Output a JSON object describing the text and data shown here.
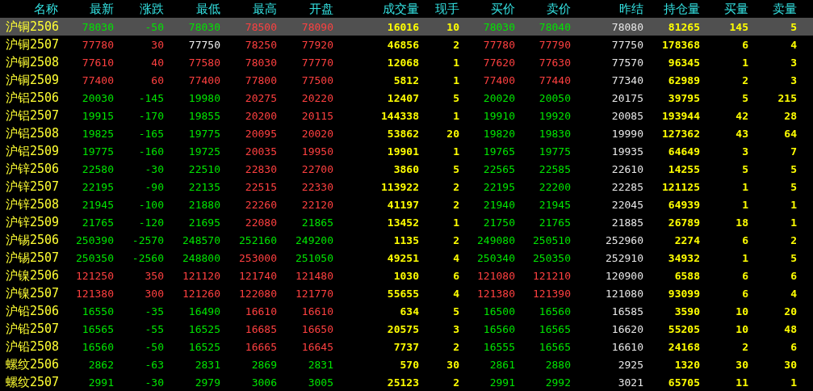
{
  "table": {
    "columns": [
      {
        "label": "名称",
        "kind": "name"
      },
      {
        "label": "最新",
        "kind": "price"
      },
      {
        "label": "涨跌",
        "kind": "price"
      },
      {
        "label": "最低",
        "kind": "price"
      },
      {
        "label": "最高",
        "kind": "price"
      },
      {
        "label": "开盘",
        "kind": "price"
      },
      {
        "label": "成交量",
        "kind": "volume"
      },
      {
        "label": "现手",
        "kind": "volume"
      },
      {
        "label": "买价",
        "kind": "price"
      },
      {
        "label": "卖价",
        "kind": "price"
      },
      {
        "label": "昨结",
        "kind": "ref"
      },
      {
        "label": "持仓量",
        "kind": "volume"
      },
      {
        "label": "买量",
        "kind": "volume"
      },
      {
        "label": "卖量",
        "kind": "volume"
      }
    ],
    "rows": [
      {
        "selected": true,
        "cells": [
          {
            "text": "沪铜2506"
          },
          {
            "text": "78030",
            "color": "#00e600"
          },
          {
            "text": "-50",
            "color": "#00e600"
          },
          {
            "text": "78030",
            "color": "#00e600"
          },
          {
            "text": "78500",
            "color": "#ff4040"
          },
          {
            "text": "78090",
            "color": "#ff4040"
          },
          {
            "text": "16016"
          },
          {
            "text": "10"
          },
          {
            "text": "78030",
            "color": "#00e600"
          },
          {
            "text": "78040",
            "color": "#00e600"
          },
          {
            "text": "78080"
          },
          {
            "text": "81265"
          },
          {
            "text": "145"
          },
          {
            "text": "5"
          }
        ]
      },
      {
        "selected": false,
        "cells": [
          {
            "text": "沪铜2507"
          },
          {
            "text": "77780",
            "color": "#ff4040"
          },
          {
            "text": "30",
            "color": "#ff4040"
          },
          {
            "text": "77750",
            "color": "#f0f0f0"
          },
          {
            "text": "78250",
            "color": "#ff4040"
          },
          {
            "text": "77920",
            "color": "#ff4040"
          },
          {
            "text": "46856"
          },
          {
            "text": "2"
          },
          {
            "text": "77780",
            "color": "#ff4040"
          },
          {
            "text": "77790",
            "color": "#ff4040"
          },
          {
            "text": "77750"
          },
          {
            "text": "178368"
          },
          {
            "text": "6"
          },
          {
            "text": "4"
          }
        ]
      },
      {
        "selected": false,
        "cells": [
          {
            "text": "沪铜2508"
          },
          {
            "text": "77610",
            "color": "#ff4040"
          },
          {
            "text": "40",
            "color": "#ff4040"
          },
          {
            "text": "77580",
            "color": "#ff4040"
          },
          {
            "text": "78030",
            "color": "#ff4040"
          },
          {
            "text": "77770",
            "color": "#ff4040"
          },
          {
            "text": "12068"
          },
          {
            "text": "1"
          },
          {
            "text": "77620",
            "color": "#ff4040"
          },
          {
            "text": "77630",
            "color": "#ff4040"
          },
          {
            "text": "77570"
          },
          {
            "text": "96345"
          },
          {
            "text": "1"
          },
          {
            "text": "3"
          }
        ]
      },
      {
        "selected": false,
        "cells": [
          {
            "text": "沪铜2509"
          },
          {
            "text": "77400",
            "color": "#ff4040"
          },
          {
            "text": "60",
            "color": "#ff4040"
          },
          {
            "text": "77400",
            "color": "#ff4040"
          },
          {
            "text": "77800",
            "color": "#ff4040"
          },
          {
            "text": "77500",
            "color": "#ff4040"
          },
          {
            "text": "5812"
          },
          {
            "text": "1"
          },
          {
            "text": "77400",
            "color": "#ff4040"
          },
          {
            "text": "77440",
            "color": "#ff4040"
          },
          {
            "text": "77340"
          },
          {
            "text": "62989"
          },
          {
            "text": "2"
          },
          {
            "text": "3"
          }
        ]
      },
      {
        "selected": false,
        "cells": [
          {
            "text": "沪铝2506"
          },
          {
            "text": "20030",
            "color": "#00e600"
          },
          {
            "text": "-145",
            "color": "#00e600"
          },
          {
            "text": "19980",
            "color": "#00e600"
          },
          {
            "text": "20275",
            "color": "#ff4040"
          },
          {
            "text": "20220",
            "color": "#ff4040"
          },
          {
            "text": "12407"
          },
          {
            "text": "5"
          },
          {
            "text": "20020",
            "color": "#00e600"
          },
          {
            "text": "20050",
            "color": "#00e600"
          },
          {
            "text": "20175"
          },
          {
            "text": "39795"
          },
          {
            "text": "5"
          },
          {
            "text": "215"
          }
        ]
      },
      {
        "selected": false,
        "cells": [
          {
            "text": "沪铝2507"
          },
          {
            "text": "19915",
            "color": "#00e600"
          },
          {
            "text": "-170",
            "color": "#00e600"
          },
          {
            "text": "19855",
            "color": "#00e600"
          },
          {
            "text": "20200",
            "color": "#ff4040"
          },
          {
            "text": "20115",
            "color": "#ff4040"
          },
          {
            "text": "144338"
          },
          {
            "text": "1"
          },
          {
            "text": "19910",
            "color": "#00e600"
          },
          {
            "text": "19920",
            "color": "#00e600"
          },
          {
            "text": "20085"
          },
          {
            "text": "193944"
          },
          {
            "text": "42"
          },
          {
            "text": "28"
          }
        ]
      },
      {
        "selected": false,
        "cells": [
          {
            "text": "沪铝2508"
          },
          {
            "text": "19825",
            "color": "#00e600"
          },
          {
            "text": "-165",
            "color": "#00e600"
          },
          {
            "text": "19775",
            "color": "#00e600"
          },
          {
            "text": "20095",
            "color": "#ff4040"
          },
          {
            "text": "20020",
            "color": "#ff4040"
          },
          {
            "text": "53862"
          },
          {
            "text": "20"
          },
          {
            "text": "19820",
            "color": "#00e600"
          },
          {
            "text": "19830",
            "color": "#00e600"
          },
          {
            "text": "19990"
          },
          {
            "text": "127362"
          },
          {
            "text": "43"
          },
          {
            "text": "64"
          }
        ]
      },
      {
        "selected": false,
        "cells": [
          {
            "text": "沪铝2509"
          },
          {
            "text": "19775",
            "color": "#00e600"
          },
          {
            "text": "-160",
            "color": "#00e600"
          },
          {
            "text": "19725",
            "color": "#00e600"
          },
          {
            "text": "20035",
            "color": "#ff4040"
          },
          {
            "text": "19950",
            "color": "#ff4040"
          },
          {
            "text": "19901"
          },
          {
            "text": "1"
          },
          {
            "text": "19765",
            "color": "#00e600"
          },
          {
            "text": "19775",
            "color": "#00e600"
          },
          {
            "text": "19935"
          },
          {
            "text": "64649"
          },
          {
            "text": "3"
          },
          {
            "text": "7"
          }
        ]
      },
      {
        "selected": false,
        "cells": [
          {
            "text": "沪锌2506"
          },
          {
            "text": "22580",
            "color": "#00e600"
          },
          {
            "text": "-30",
            "color": "#00e600"
          },
          {
            "text": "22510",
            "color": "#00e600"
          },
          {
            "text": "22830",
            "color": "#ff4040"
          },
          {
            "text": "22700",
            "color": "#ff4040"
          },
          {
            "text": "3860"
          },
          {
            "text": "5"
          },
          {
            "text": "22565",
            "color": "#00e600"
          },
          {
            "text": "22585",
            "color": "#00e600"
          },
          {
            "text": "22610"
          },
          {
            "text": "14255"
          },
          {
            "text": "5"
          },
          {
            "text": "5"
          }
        ]
      },
      {
        "selected": false,
        "cells": [
          {
            "text": "沪锌2507"
          },
          {
            "text": "22195",
            "color": "#00e600"
          },
          {
            "text": "-90",
            "color": "#00e600"
          },
          {
            "text": "22135",
            "color": "#00e600"
          },
          {
            "text": "22515",
            "color": "#ff4040"
          },
          {
            "text": "22330",
            "color": "#ff4040"
          },
          {
            "text": "113922"
          },
          {
            "text": "2"
          },
          {
            "text": "22195",
            "color": "#00e600"
          },
          {
            "text": "22200",
            "color": "#00e600"
          },
          {
            "text": "22285"
          },
          {
            "text": "121125"
          },
          {
            "text": "1"
          },
          {
            "text": "5"
          }
        ]
      },
      {
        "selected": false,
        "cells": [
          {
            "text": "沪锌2508"
          },
          {
            "text": "21945",
            "color": "#00e600"
          },
          {
            "text": "-100",
            "color": "#00e600"
          },
          {
            "text": "21880",
            "color": "#00e600"
          },
          {
            "text": "22260",
            "color": "#ff4040"
          },
          {
            "text": "22120",
            "color": "#ff4040"
          },
          {
            "text": "41197"
          },
          {
            "text": "2"
          },
          {
            "text": "21940",
            "color": "#00e600"
          },
          {
            "text": "21945",
            "color": "#00e600"
          },
          {
            "text": "22045"
          },
          {
            "text": "64939"
          },
          {
            "text": "1"
          },
          {
            "text": "1"
          }
        ]
      },
      {
        "selected": false,
        "cells": [
          {
            "text": "沪锌2509"
          },
          {
            "text": "21765",
            "color": "#00e600"
          },
          {
            "text": "-120",
            "color": "#00e600"
          },
          {
            "text": "21695",
            "color": "#00e600"
          },
          {
            "text": "22080",
            "color": "#ff4040"
          },
          {
            "text": "21865",
            "color": "#00e600"
          },
          {
            "text": "13452"
          },
          {
            "text": "1"
          },
          {
            "text": "21750",
            "color": "#00e600"
          },
          {
            "text": "21765",
            "color": "#00e600"
          },
          {
            "text": "21885"
          },
          {
            "text": "26789"
          },
          {
            "text": "18"
          },
          {
            "text": "1"
          }
        ]
      },
      {
        "selected": false,
        "cells": [
          {
            "text": "沪锡2506"
          },
          {
            "text": "250390",
            "color": "#00e600"
          },
          {
            "text": "-2570",
            "color": "#00e600"
          },
          {
            "text": "248570",
            "color": "#00e600"
          },
          {
            "text": "252160",
            "color": "#00e600"
          },
          {
            "text": "249200",
            "color": "#00e600"
          },
          {
            "text": "1135"
          },
          {
            "text": "2"
          },
          {
            "text": "249080",
            "color": "#00e600"
          },
          {
            "text": "250510",
            "color": "#00e600"
          },
          {
            "text": "252960"
          },
          {
            "text": "2274"
          },
          {
            "text": "6"
          },
          {
            "text": "2"
          }
        ]
      },
      {
        "selected": false,
        "cells": [
          {
            "text": "沪锡2507"
          },
          {
            "text": "250350",
            "color": "#00e600"
          },
          {
            "text": "-2560",
            "color": "#00e600"
          },
          {
            "text": "248800",
            "color": "#00e600"
          },
          {
            "text": "253000",
            "color": "#ff4040"
          },
          {
            "text": "251050",
            "color": "#00e600"
          },
          {
            "text": "49251"
          },
          {
            "text": "4"
          },
          {
            "text": "250340",
            "color": "#00e600"
          },
          {
            "text": "250350",
            "color": "#00e600"
          },
          {
            "text": "252910"
          },
          {
            "text": "34932"
          },
          {
            "text": "1"
          },
          {
            "text": "5"
          }
        ]
      },
      {
        "selected": false,
        "cells": [
          {
            "text": "沪镍2506"
          },
          {
            "text": "121250",
            "color": "#ff4040"
          },
          {
            "text": "350",
            "color": "#ff4040"
          },
          {
            "text": "121120",
            "color": "#ff4040"
          },
          {
            "text": "121740",
            "color": "#ff4040"
          },
          {
            "text": "121480",
            "color": "#ff4040"
          },
          {
            "text": "1030"
          },
          {
            "text": "6"
          },
          {
            "text": "121080",
            "color": "#ff4040"
          },
          {
            "text": "121210",
            "color": "#ff4040"
          },
          {
            "text": "120900"
          },
          {
            "text": "6588"
          },
          {
            "text": "6"
          },
          {
            "text": "6"
          }
        ]
      },
      {
        "selected": false,
        "cells": [
          {
            "text": "沪镍2507"
          },
          {
            "text": "121380",
            "color": "#ff4040"
          },
          {
            "text": "300",
            "color": "#ff4040"
          },
          {
            "text": "121260",
            "color": "#ff4040"
          },
          {
            "text": "122080",
            "color": "#ff4040"
          },
          {
            "text": "121770",
            "color": "#ff4040"
          },
          {
            "text": "55655"
          },
          {
            "text": "4"
          },
          {
            "text": "121380",
            "color": "#ff4040"
          },
          {
            "text": "121390",
            "color": "#ff4040"
          },
          {
            "text": "121080"
          },
          {
            "text": "93099"
          },
          {
            "text": "6"
          },
          {
            "text": "4"
          }
        ]
      },
      {
        "selected": false,
        "cells": [
          {
            "text": "沪铅2506"
          },
          {
            "text": "16550",
            "color": "#00e600"
          },
          {
            "text": "-35",
            "color": "#00e600"
          },
          {
            "text": "16490",
            "color": "#00e600"
          },
          {
            "text": "16610",
            "color": "#ff4040"
          },
          {
            "text": "16610",
            "color": "#ff4040"
          },
          {
            "text": "634"
          },
          {
            "text": "5"
          },
          {
            "text": "16500",
            "color": "#00e600"
          },
          {
            "text": "16560",
            "color": "#00e600"
          },
          {
            "text": "16585"
          },
          {
            "text": "3590"
          },
          {
            "text": "10"
          },
          {
            "text": "20"
          }
        ]
      },
      {
        "selected": false,
        "cells": [
          {
            "text": "沪铅2507"
          },
          {
            "text": "16565",
            "color": "#00e600"
          },
          {
            "text": "-55",
            "color": "#00e600"
          },
          {
            "text": "16525",
            "color": "#00e600"
          },
          {
            "text": "16685",
            "color": "#ff4040"
          },
          {
            "text": "16650",
            "color": "#ff4040"
          },
          {
            "text": "20575"
          },
          {
            "text": "3"
          },
          {
            "text": "16560",
            "color": "#00e600"
          },
          {
            "text": "16565",
            "color": "#00e600"
          },
          {
            "text": "16620"
          },
          {
            "text": "55205"
          },
          {
            "text": "10"
          },
          {
            "text": "48"
          }
        ]
      },
      {
        "selected": false,
        "cells": [
          {
            "text": "沪铅2508"
          },
          {
            "text": "16560",
            "color": "#00e600"
          },
          {
            "text": "-50",
            "color": "#00e600"
          },
          {
            "text": "16525",
            "color": "#00e600"
          },
          {
            "text": "16665",
            "color": "#ff4040"
          },
          {
            "text": "16645",
            "color": "#ff4040"
          },
          {
            "text": "7737"
          },
          {
            "text": "2"
          },
          {
            "text": "16555",
            "color": "#00e600"
          },
          {
            "text": "16565",
            "color": "#00e600"
          },
          {
            "text": "16610"
          },
          {
            "text": "24168"
          },
          {
            "text": "2"
          },
          {
            "text": "6"
          }
        ]
      },
      {
        "selected": false,
        "cells": [
          {
            "text": "螺纹2506"
          },
          {
            "text": "2862",
            "color": "#00e600"
          },
          {
            "text": "-63",
            "color": "#00e600"
          },
          {
            "text": "2831",
            "color": "#00e600"
          },
          {
            "text": "2869",
            "color": "#00e600"
          },
          {
            "text": "2831",
            "color": "#00e600"
          },
          {
            "text": "570"
          },
          {
            "text": "30"
          },
          {
            "text": "2861",
            "color": "#00e600"
          },
          {
            "text": "2880",
            "color": "#00e600"
          },
          {
            "text": "2925"
          },
          {
            "text": "1320"
          },
          {
            "text": "30"
          },
          {
            "text": "30"
          }
        ]
      },
      {
        "selected": false,
        "cells": [
          {
            "text": "螺纹2507"
          },
          {
            "text": "2991",
            "color": "#00e600"
          },
          {
            "text": "-30",
            "color": "#00e600"
          },
          {
            "text": "2979",
            "color": "#00e600"
          },
          {
            "text": "3006",
            "color": "#00e600"
          },
          {
            "text": "3005",
            "color": "#00e600"
          },
          {
            "text": "25123"
          },
          {
            "text": "2"
          },
          {
            "text": "2991",
            "color": "#00e600"
          },
          {
            "text": "2992",
            "color": "#00e600"
          },
          {
            "text": "3021"
          },
          {
            "text": "65705"
          },
          {
            "text": "11"
          },
          {
            "text": "1"
          }
        ]
      }
    ]
  }
}
